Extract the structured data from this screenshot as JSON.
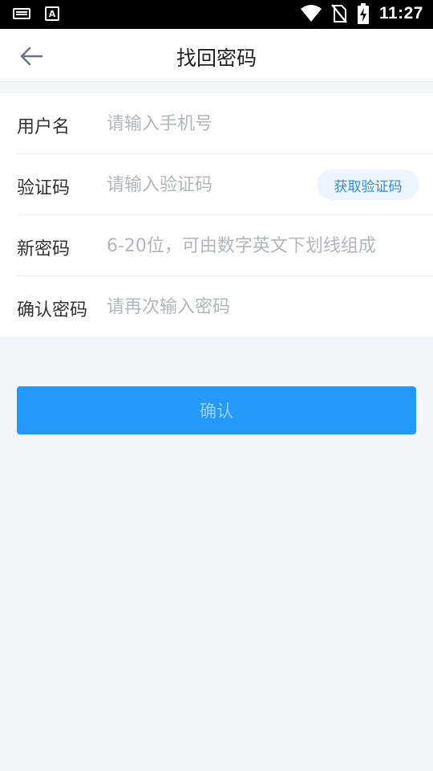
{
  "status_bar": {
    "time": "11:27",
    "icons": [
      "keyboard-icon",
      "a-notification-icon",
      "wifi-icon",
      "no-sim-icon",
      "battery-charging-icon"
    ]
  },
  "header": {
    "back_icon": "arrow-left-icon",
    "title": "找回密码"
  },
  "form": {
    "username": {
      "label": "用户名",
      "placeholder": "请输入手机号"
    },
    "code": {
      "label": "验证码",
      "placeholder": "请输入验证码",
      "button_label": "获取验证码"
    },
    "new_password": {
      "label": "新密码",
      "placeholder": "6-20位，可由数字英文下划线组成"
    },
    "confirm_password": {
      "label": "确认密码",
      "placeholder": "请再次输入密码"
    }
  },
  "actions": {
    "confirm_label": "确认"
  },
  "colors": {
    "primary": "#2399fc",
    "link": "#2b8ee8",
    "background": "#f3f5f9"
  }
}
